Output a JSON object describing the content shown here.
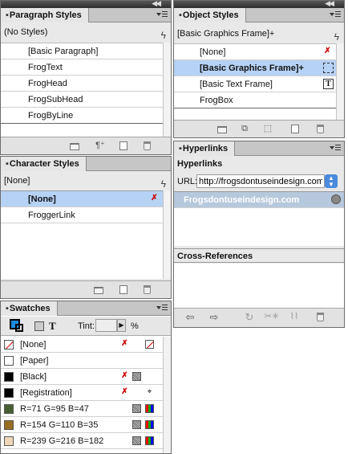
{
  "paragraph_styles": {
    "tab": "Paragraph Styles",
    "current": "(No Styles)",
    "items": [
      "[Basic Paragraph]",
      "FrogText",
      "FrogHead",
      "FrogSubHead",
      "FrogByLine"
    ]
  },
  "character_styles": {
    "tab": "Character Styles",
    "current": "[None]",
    "items": [
      "[None]",
      "FroggerLink"
    ]
  },
  "swatches": {
    "tab": "Swatches",
    "tint_label": "Tint:",
    "tint_value": "",
    "percent": "%",
    "items": [
      {
        "name": "[None]",
        "color": "#ffffff"
      },
      {
        "name": "[Paper]",
        "color": "#ffffff"
      },
      {
        "name": "[Black]",
        "color": "#000000"
      },
      {
        "name": "[Registration]",
        "color": "#000000"
      },
      {
        "name": "R=71 G=95 B=47",
        "color": "#475f2f"
      },
      {
        "name": "R=154 G=110 B=35",
        "color": "#9a6e23"
      },
      {
        "name": "R=239 G=216 B=182",
        "color": "#efd8b6"
      }
    ]
  },
  "object_styles": {
    "tab": "Object Styles",
    "current": "[Basic Graphics Frame]+",
    "items": [
      "[None]",
      "[Basic Graphics Frame]+",
      "[Basic Text Frame]",
      "FrogBox"
    ]
  },
  "hyperlinks": {
    "tab": "Hyperlinks",
    "heading": "Hyperlinks",
    "url_label": "URL:",
    "url_value": "http://frogsdontuseindesign.com",
    "items": [
      "Frogsdontuseindesign.com"
    ],
    "cross_refs_heading": "Cross-References"
  }
}
